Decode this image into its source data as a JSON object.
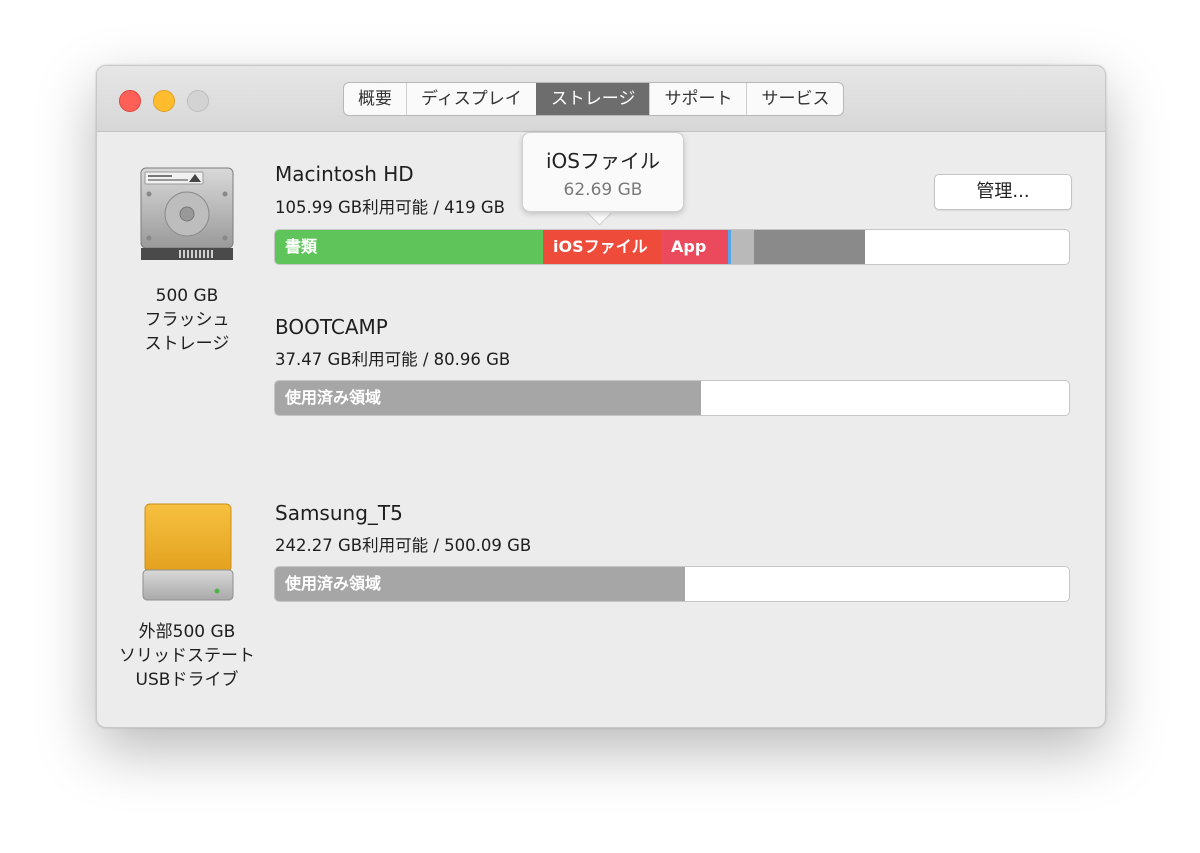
{
  "window": {
    "tabs": [
      {
        "label": "概要",
        "active": false
      },
      {
        "label": "ディスプレイ",
        "active": false
      },
      {
        "label": "ストレージ",
        "active": true
      },
      {
        "label": "サポート",
        "active": false
      },
      {
        "label": "サービス",
        "active": false
      }
    ]
  },
  "devices": [
    {
      "icon": "internal-hard-drive-icon",
      "caption_lines": [
        "500 GB",
        "フラッシュ",
        "ストレージ"
      ],
      "volumes": [
        {
          "name": "Macintosh HD",
          "capacity": "105.99 GB利用可能 / 419 GB",
          "manage_label": "管理...",
          "usage": [
            {
              "label": "書類",
              "fraction": 0.338,
              "color": "#5fc45a"
            },
            {
              "label": "iOSファイル",
              "fraction": 0.149,
              "color": "#ee4b3b"
            },
            {
              "label": "App",
              "fraction": 0.084,
              "color": "#ea4a5c"
            },
            {
              "label": "",
              "fraction": 0.004,
              "color": "#55a6e9"
            },
            {
              "label": "",
              "fraction": 0.029,
              "color": "#b9b9b9"
            },
            {
              "label": "",
              "fraction": 0.14,
              "color": "#8a8a8a"
            }
          ]
        },
        {
          "name": "BOOTCAMP",
          "capacity": "37.47 GB利用可能 / 80.96 GB",
          "usage": [
            {
              "label": "使用済み領域",
              "fraction": 0.537,
              "color": "#a6a6a6"
            }
          ]
        }
      ]
    },
    {
      "icon": "external-ssd-icon",
      "caption_lines": [
        "外部500 GB",
        "ソリッドステート",
        "USBドライブ"
      ],
      "volumes": [
        {
          "name": "Samsung_T5",
          "capacity": "242.27 GB利用可能 / 500.09 GB",
          "usage": [
            {
              "label": "使用済み領域",
              "fraction": 0.516,
              "color": "#a6a6a6"
            }
          ]
        }
      ]
    }
  ],
  "tooltip": {
    "title": "iOSファイル",
    "size": "62.69 GB"
  }
}
